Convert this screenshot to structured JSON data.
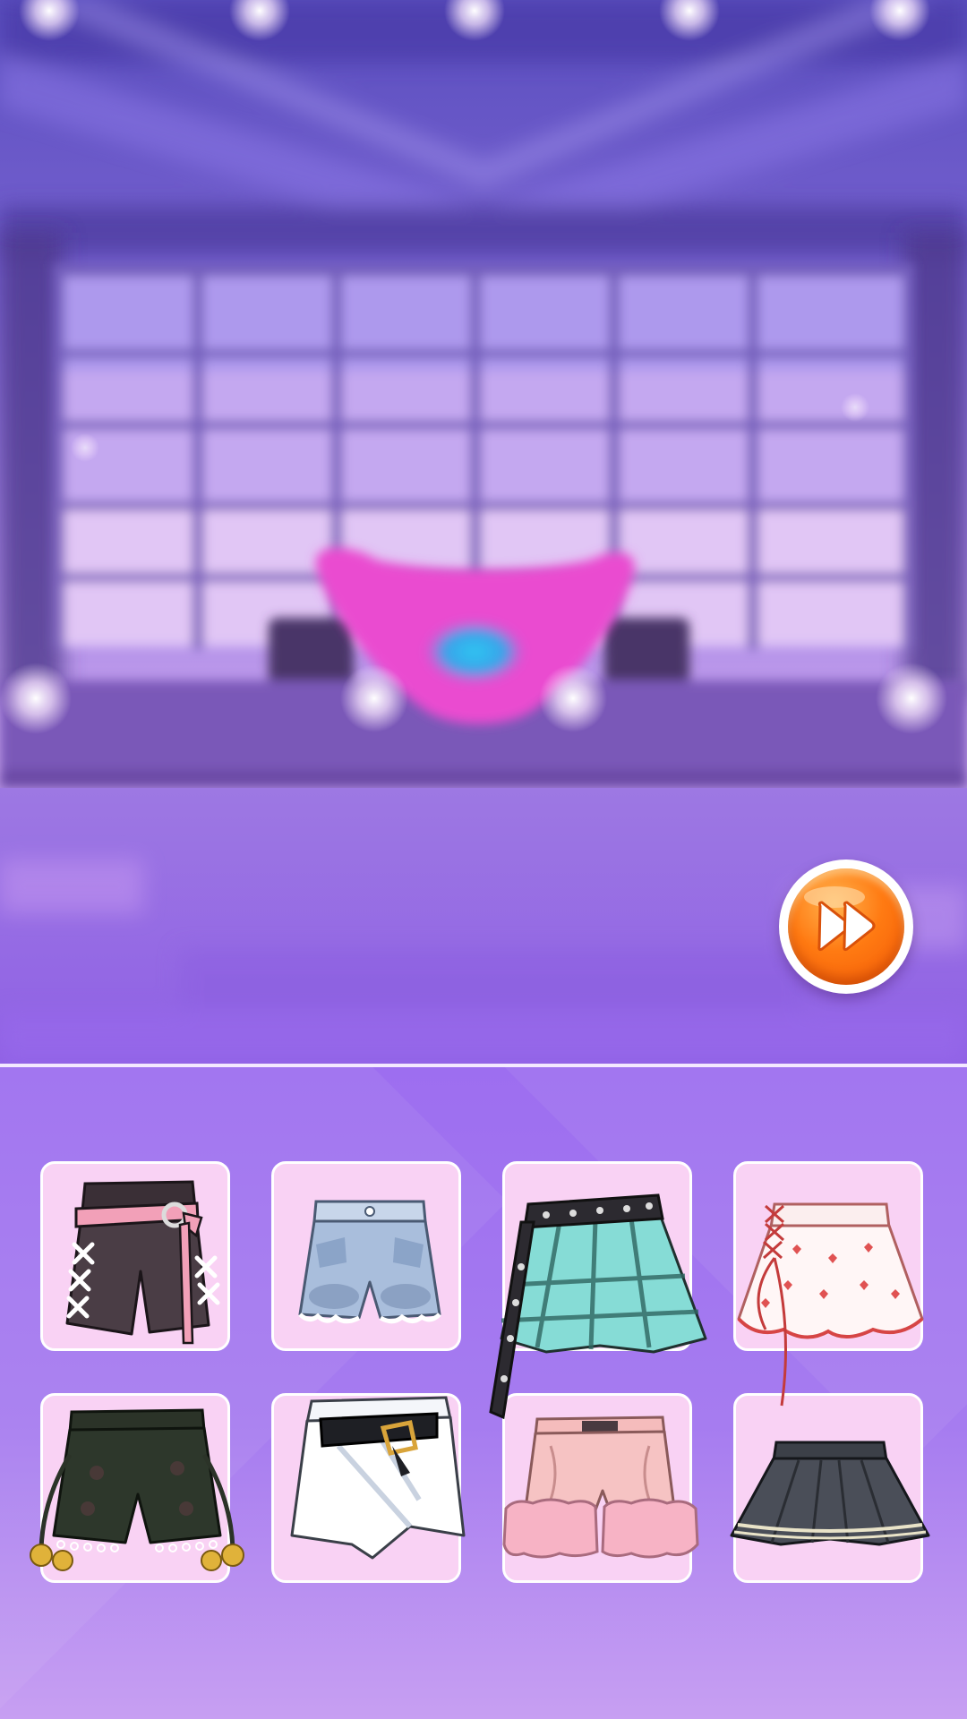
{
  "colors": {
    "panel_top": "#9d6ef0",
    "panel_bottom": "#c79ff2",
    "slot_background": "#f9d2f4",
    "slot_border": "#ffffff",
    "ff_button": "#ff7a12"
  },
  "controls": {
    "skip_button_icon": "fast-forward-icon"
  },
  "wardrobe": {
    "category": "bottoms",
    "items": [
      {
        "icon": "black-laced-shorts-with-pink-belt-icon"
      },
      {
        "icon": "denim-shorts-icon"
      },
      {
        "icon": "teal-plaid-skirt-with-studded-belt-icon"
      },
      {
        "icon": "white-heart-print-skirt-icon"
      },
      {
        "icon": "black-shorts-with-bells-icon"
      },
      {
        "icon": "white-wrap-skirt-with-black-belt-icon"
      },
      {
        "icon": "pink-fur-trim-shorts-icon"
      },
      {
        "icon": "dark-gray-pleated-skirt-icon"
      }
    ]
  }
}
